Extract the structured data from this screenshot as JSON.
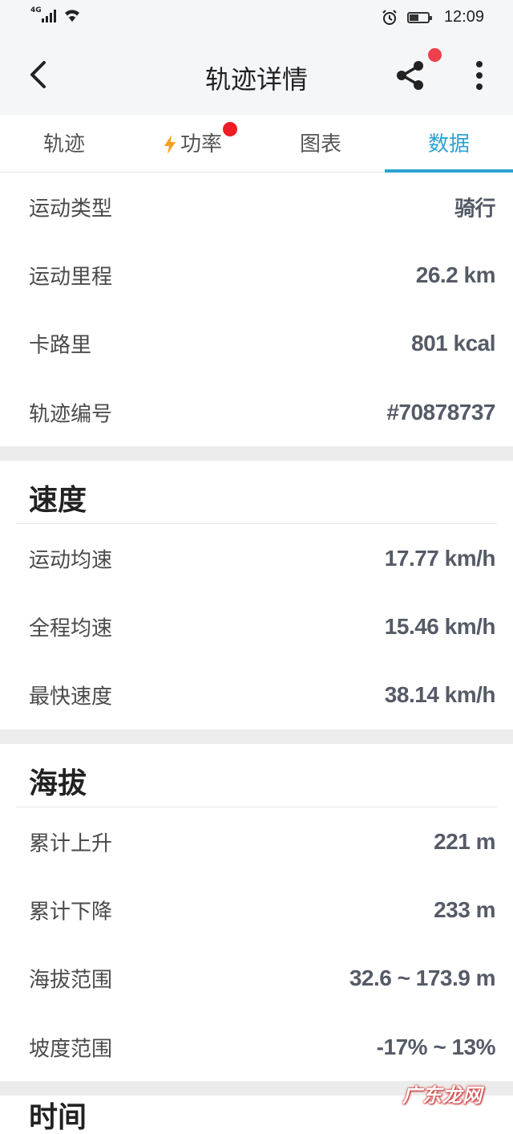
{
  "status_bar": {
    "network": "4G",
    "time": "12:09"
  },
  "app_bar": {
    "title": "轨迹详情"
  },
  "tabs": [
    {
      "label": "轨迹"
    },
    {
      "label": "功率"
    },
    {
      "label": "图表"
    },
    {
      "label": "数据"
    }
  ],
  "summary": [
    {
      "label": "运动类型",
      "value": "骑行"
    },
    {
      "label": "运动里程",
      "value": "26.2 km"
    },
    {
      "label": "卡路里",
      "value": "801 kcal"
    },
    {
      "label": "轨迹编号",
      "value": "#70878737"
    }
  ],
  "speed": {
    "title": "速度",
    "rows": [
      {
        "label": "运动均速",
        "value": "17.77 km/h"
      },
      {
        "label": "全程均速",
        "value": "15.46 km/h"
      },
      {
        "label": "最快速度",
        "value": "38.14 km/h"
      }
    ]
  },
  "altitude": {
    "title": "海拔",
    "rows": [
      {
        "label": "累计上升",
        "value": "221 m"
      },
      {
        "label": "累计下降",
        "value": "233 m"
      },
      {
        "label": "海拔范围",
        "value": "32.6 ~ 173.9 m"
      },
      {
        "label": "坡度范围",
        "value": "-17% ~ 13%"
      }
    ]
  },
  "next_section_title": "时间",
  "watermark": "广东龙网",
  "colors": {
    "accent": "#2ba3d2",
    "badge": "#ee1c25",
    "value_text": "#555b66",
    "power_icon": "#f5a11c"
  },
  "icons": {
    "back": "chevron-left-icon",
    "share": "share-icon",
    "more": "more-vertical-icon",
    "power": "lightning-icon"
  }
}
